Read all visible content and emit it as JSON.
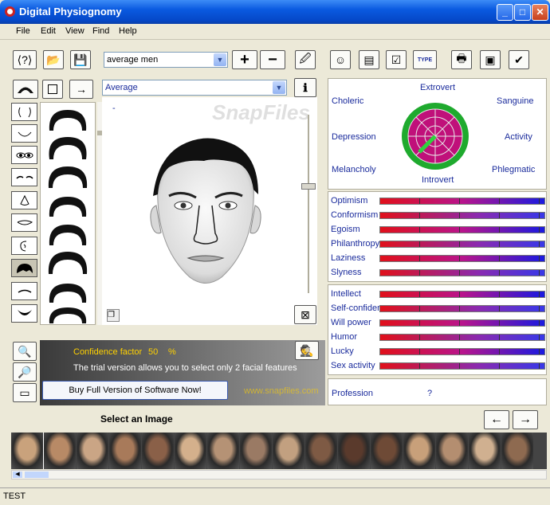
{
  "window": {
    "title": "Digital Physiognomy"
  },
  "menu": {
    "items": [
      "File",
      "Edit",
      "View",
      "Find",
      "Help"
    ]
  },
  "toolbar": {
    "preset_select": "average men",
    "plus_label": "+",
    "minus_label": "−"
  },
  "editor": {
    "feature_select": "Average",
    "dash_label": "-"
  },
  "temperament": {
    "top": "Extrovert",
    "bottom": "Introvert",
    "choleric": "Choleric",
    "sanguine": "Sanguine",
    "depression": "Depression",
    "activity": "Activity",
    "melancholy": "Melancholy",
    "phlegmatic": "Phlegmatic"
  },
  "traits1": [
    {
      "label": "Optimism"
    },
    {
      "label": "Conformism"
    },
    {
      "label": "Egoism"
    },
    {
      "label": "Philanthropy"
    },
    {
      "label": "Laziness"
    },
    {
      "label": "Slyness"
    }
  ],
  "traits2": [
    {
      "label": "Intellect"
    },
    {
      "label": "Self-confidence"
    },
    {
      "label": "Will power"
    },
    {
      "label": "Humor"
    },
    {
      "label": "Lucky"
    },
    {
      "label": "Sex activity"
    }
  ],
  "profession": {
    "label": "Profession",
    "value": "?"
  },
  "info": {
    "confidence_label": "Confidence factor",
    "confidence_value": "50",
    "percent": "%",
    "trial_text": "The trial version allows you to select only 2 facial features",
    "buy_button": "Buy Full Version of Software Now!",
    "site_text": "www.snapfiles.com"
  },
  "gallery": {
    "title": "Select an Image"
  },
  "status": {
    "text": "TEST"
  },
  "watermark": "SnapFiles",
  "colors": {
    "title_blue": "#0a5ae0",
    "label_blue": "#1a2b9c",
    "confidence_yellow": "#ffd100",
    "bar_red": "#e0101a",
    "bar_blue": "#1a1ae0"
  }
}
